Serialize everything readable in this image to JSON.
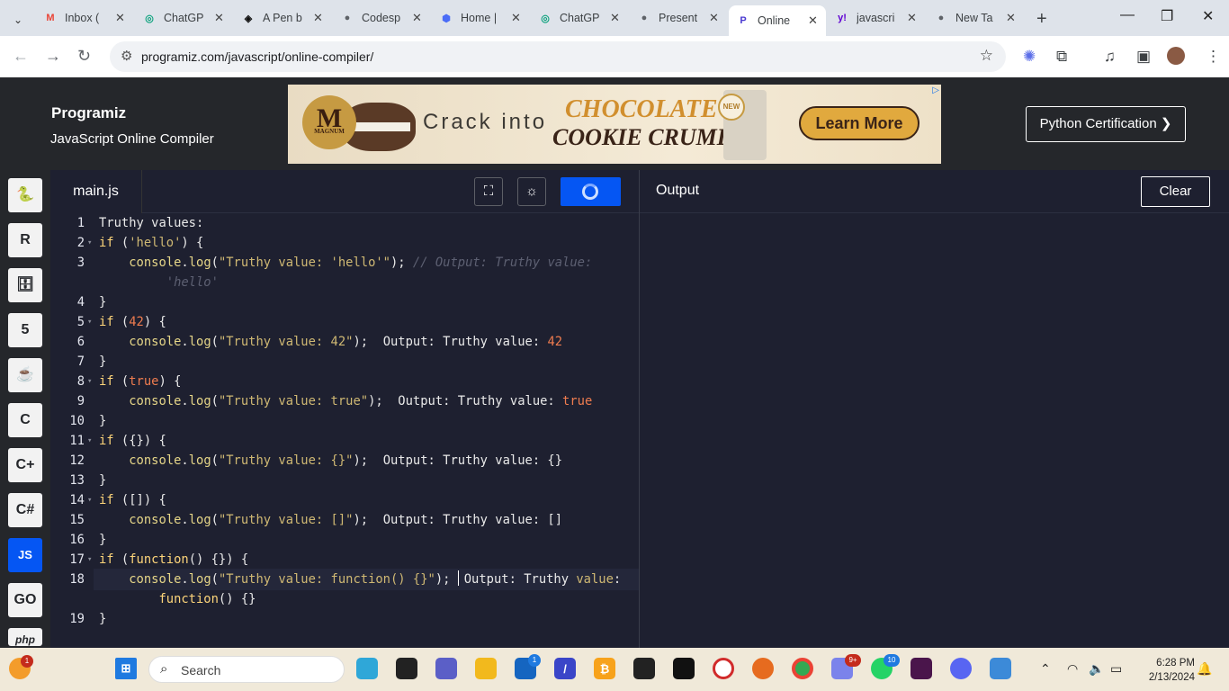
{
  "browser": {
    "tabs": [
      {
        "label": "Inbox (",
        "icon": "gmail-icon"
      },
      {
        "label": "ChatGP",
        "icon": "chatgpt-icon"
      },
      {
        "label": "A Pen b",
        "icon": "codepen-icon"
      },
      {
        "label": "Codesp",
        "icon": "globe-icon"
      },
      {
        "label": "Home |",
        "icon": "home-icon"
      },
      {
        "label": "ChatGP",
        "icon": "chatgpt-icon"
      },
      {
        "label": "Present",
        "icon": "globe-icon"
      },
      {
        "label": "Online",
        "icon": "programiz-icon",
        "active": true
      },
      {
        "label": "javascri",
        "icon": "yahoo-icon"
      },
      {
        "label": "New Ta",
        "icon": "globe-icon"
      }
    ],
    "close_glyph": "✕",
    "new_tab_glyph": "+",
    "url": "programiz.com/javascript/online-compiler/"
  },
  "header": {
    "logo": "Programiz",
    "subtitle": "JavaScript Online Compiler",
    "cert_button": "Python Certification ❯"
  },
  "ad": {
    "brand": "M",
    "brand_small": "MAGNUM",
    "tagline": "Crack into",
    "product_line1": "CHOCOLATE",
    "product_line2": "COOKIE CRUMBLE",
    "badge": "NEW",
    "cta": "Learn More"
  },
  "sidebar": {
    "items": [
      {
        "label": "🐍",
        "name": "python-icon"
      },
      {
        "label": "R",
        "name": "r-language-icon"
      },
      {
        "label": "🗄",
        "name": "sql-icon"
      },
      {
        "label": "5",
        "name": "html-icon"
      },
      {
        "label": "☕",
        "name": "java-icon"
      },
      {
        "label": "C",
        "name": "c-icon"
      },
      {
        "label": "C+",
        "name": "cpp-icon"
      },
      {
        "label": "C#",
        "name": "csharp-icon"
      },
      {
        "label": "JS",
        "name": "javascript-icon",
        "active": true
      },
      {
        "label": "GO",
        "name": "go-icon"
      },
      {
        "label": "php",
        "name": "php-icon"
      }
    ]
  },
  "editor": {
    "filename": "main.js",
    "lines": [
      {
        "n": "1",
        "fold": false,
        "html": "Truthy values:"
      },
      {
        "n": "2",
        "fold": true,
        "html": "<span class='kw'>if</span> (<span class='str'>'hello'</span>) {"
      },
      {
        "n": "3",
        "fold": false,
        "html": "    <span class='fn'>console</span>.<span class='fn'>log</span>(<span class='str'>\"Truthy value: 'hello'\"</span>); <span class='cm'>// Output: Truthy value:</span>"
      },
      {
        "n": "",
        "fold": false,
        "html": "         <span class='cm'>'hello'</span>"
      },
      {
        "n": "4",
        "fold": false,
        "html": "}"
      },
      {
        "n": "5",
        "fold": true,
        "html": "<span class='kw'>if</span> (<span class='num'>42</span>) {"
      },
      {
        "n": "6",
        "fold": false,
        "html": "    <span class='fn'>console</span>.<span class='fn'>log</span>(<span class='str'>\"Truthy value: 42\"</span>);  Output: Truthy value: <span class='num'>42</span>"
      },
      {
        "n": "7",
        "fold": false,
        "html": "}"
      },
      {
        "n": "8",
        "fold": true,
        "html": "<span class='kw'>if</span> (<span class='num'>true</span>) {"
      },
      {
        "n": "9",
        "fold": false,
        "html": "    <span class='fn'>console</span>.<span class='fn'>log</span>(<span class='str'>\"Truthy value: true\"</span>);  Output: Truthy value: <span class='num'>true</span>"
      },
      {
        "n": "10",
        "fold": false,
        "html": "}"
      },
      {
        "n": "11",
        "fold": true,
        "html": "<span class='kw'>if</span> ({}) {"
      },
      {
        "n": "12",
        "fold": false,
        "html": "    <span class='fn'>console</span>.<span class='fn'>log</span>(<span class='str'>\"Truthy value: {}\"</span>);  Output: Truthy value: {}"
      },
      {
        "n": "13",
        "fold": false,
        "html": "}"
      },
      {
        "n": "14",
        "fold": true,
        "html": "<span class='kw'>if</span> ([]) {"
      },
      {
        "n": "15",
        "fold": false,
        "html": "    <span class='fn'>console</span>.<span class='fn'>log</span>(<span class='str'>\"Truthy value: []\"</span>);  Output: Truthy value: []"
      },
      {
        "n": "16",
        "fold": false,
        "html": "}"
      },
      {
        "n": "17",
        "fold": true,
        "html": "<span class='kw'>if</span> (<span class='kw'>function</span>() {}) {"
      },
      {
        "n": "18",
        "fold": false,
        "html": "    <span class='fn'>console</span>.<span class='fn'>log</span>(<span class='str'>\"Truthy value: function() {}\"</span>); <span class='caret'></span>Output: Truthy <span class='str'>value</span>:"
      },
      {
        "n": "",
        "fold": false,
        "html": "        <span class='kw'>function</span>() {}"
      },
      {
        "n": "19",
        "fold": false,
        "html": "}"
      }
    ]
  },
  "output": {
    "label": "Output",
    "clear": "Clear"
  },
  "taskbar": {
    "search": "Search",
    "time": "6:28 PM",
    "date": "2/13/2024",
    "badges": {
      "weather": "1",
      "store": "1",
      "teams": "9+",
      "whatsapp": "10"
    }
  }
}
